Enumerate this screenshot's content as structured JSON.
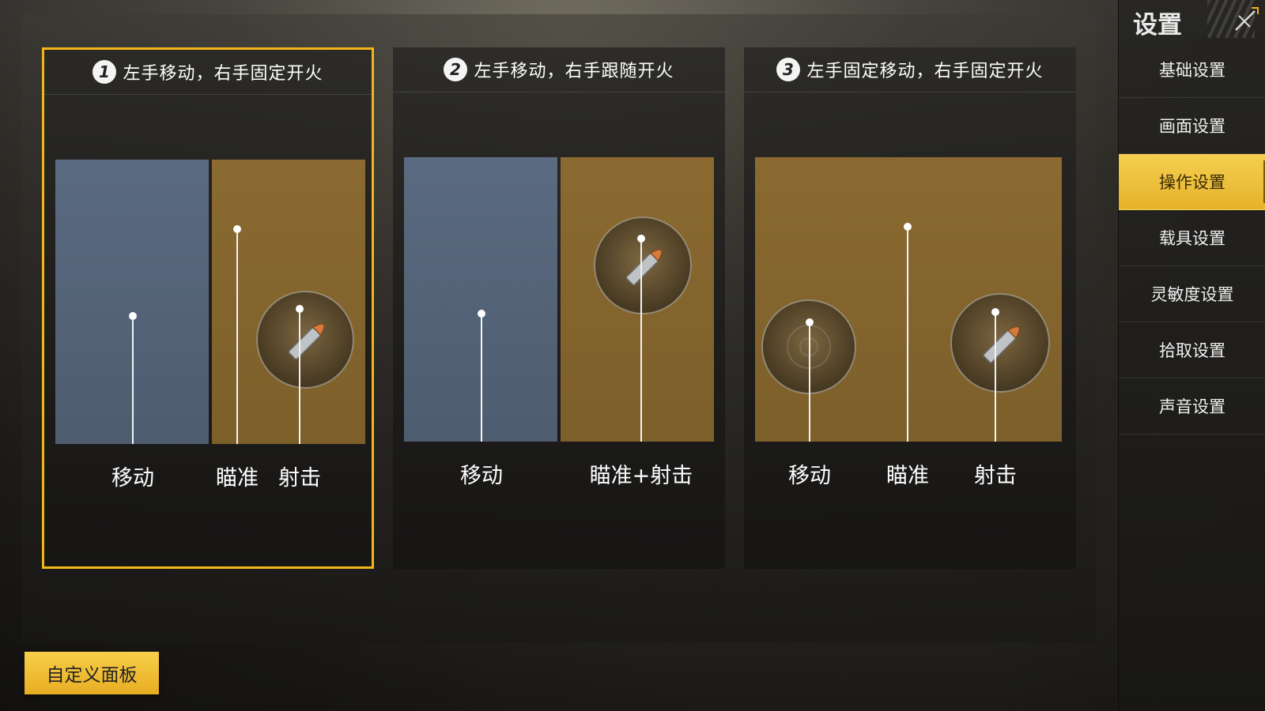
{
  "sidebar": {
    "title": "设置",
    "items": [
      {
        "label": "基础设置",
        "active": false
      },
      {
        "label": "画面设置",
        "active": false
      },
      {
        "label": "操作设置",
        "active": true
      },
      {
        "label": "载具设置",
        "active": false
      },
      {
        "label": "灵敏度设置",
        "active": false
      },
      {
        "label": "拾取设置",
        "active": false
      },
      {
        "label": "声音设置",
        "active": false
      }
    ]
  },
  "modes": [
    {
      "number": "1",
      "title": "左手移动，右手固定开火",
      "selected": true,
      "labels": [
        "移动",
        "瞄准",
        "射击"
      ]
    },
    {
      "number": "2",
      "title": "左手移动，右手跟随开火",
      "selected": false,
      "labels": [
        "移动",
        "瞄准+射击"
      ]
    },
    {
      "number": "3",
      "title": "左手固定移动，右手固定开火",
      "selected": false,
      "labels": [
        "移动",
        "瞄准",
        "射击"
      ]
    }
  ],
  "custom_panel_button": "自定义面板",
  "colors": {
    "accent": "#f2b51b",
    "move_zone": "#56667b",
    "aim_zone": "#84652d"
  }
}
